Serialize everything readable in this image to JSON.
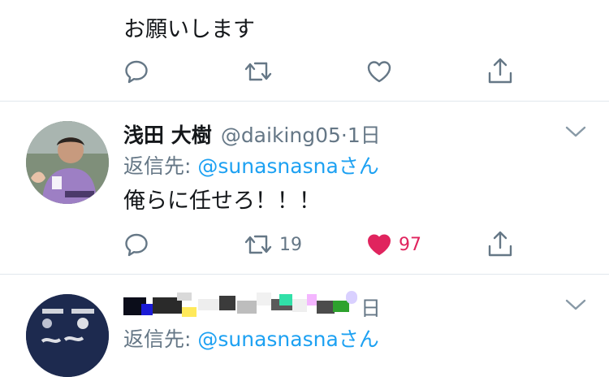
{
  "tweet1": {
    "text_line2": "お願いします"
  },
  "tweet2": {
    "display_name": "浅田 大樹",
    "handle": "@daiking05",
    "separator": "·",
    "time": "1日",
    "reply_prefix": "返信先: ",
    "reply_to": "@sunasnasnaさん",
    "text": "俺らに任せろ！！！",
    "retweet_count": "19",
    "like_count": "97",
    "liked": true
  },
  "tweet3": {
    "time_suffix": "日",
    "reply_prefix": "返信先: ",
    "reply_to": "@sunasnasnaさん"
  },
  "colors": {
    "icon_gray": "#657786",
    "like_red": "#e0245e",
    "link_blue": "#1da1f2"
  },
  "icons": [
    "reply-icon",
    "retweet-icon",
    "like-icon",
    "share-icon",
    "chevron-down-icon"
  ]
}
